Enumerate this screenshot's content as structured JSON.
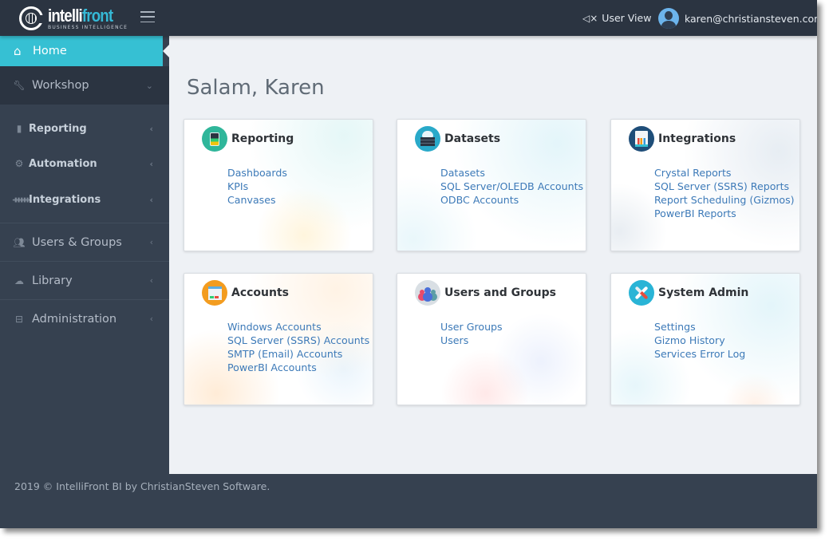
{
  "app": {
    "logo_word_a": "intelli",
    "logo_word_b": "front",
    "logo_sub": "BUSINESS INTELLIGENCE"
  },
  "topbar": {
    "user_view_label": "User View",
    "user_email": "karen@christiansteven.com"
  },
  "sidebar": {
    "home": {
      "label": "Home",
      "icon": "home-icon",
      "active": true
    },
    "workshop": {
      "label": "Workshop",
      "icon": "wrench-icon",
      "expanded": true
    },
    "workshop_children": [
      {
        "label": "Reporting",
        "icon": "file-icon"
      },
      {
        "label": "Automation",
        "icon": "cogs-icon"
      },
      {
        "label": "Integrations",
        "icon": "sitemap-icon"
      }
    ],
    "items": [
      {
        "label": "Users & Groups",
        "icon": "users-icon"
      },
      {
        "label": "Library",
        "icon": "cloud-icon"
      },
      {
        "label": "Administration",
        "icon": "briefcase-icon"
      }
    ]
  },
  "main": {
    "greeting": "Salam, Karen",
    "cards": [
      {
        "title": "Reporting",
        "icon": "tablet-chart-icon",
        "links": [
          "Dashboards",
          "KPIs",
          "Canvases"
        ]
      },
      {
        "title": "Datasets",
        "icon": "cloud-database-icon",
        "links": [
          "Datasets",
          "SQL Server/OLEDB Accounts",
          "ODBC Accounts"
        ]
      },
      {
        "title": "Integrations",
        "icon": "report-chart-icon",
        "links": [
          "Crystal Reports",
          "SQL Server (SSRS) Reports",
          "Report Scheduling (Gizmos)",
          "PowerBI Reports"
        ]
      },
      {
        "title": "Accounts",
        "icon": "account-form-icon",
        "links": [
          "Windows Accounts",
          "SQL Server (SSRS) Accounts",
          "SMTP (Email) Accounts",
          "PowerBI Accounts"
        ]
      },
      {
        "title": "Users and Groups",
        "icon": "user-group-icon",
        "links": [
          "User Groups",
          "Users"
        ]
      },
      {
        "title": "System Admin",
        "icon": "tools-icon",
        "links": [
          "Settings",
          "Gizmo History",
          "Services Error Log"
        ]
      }
    ]
  },
  "footer": {
    "text": "2019 © IntelliFront BI by ChristianSteven Software."
  },
  "colors": {
    "topbar": "#2b3441",
    "sidebar": "#364150",
    "active": "#36c0d3",
    "link": "#3d7ab8"
  }
}
